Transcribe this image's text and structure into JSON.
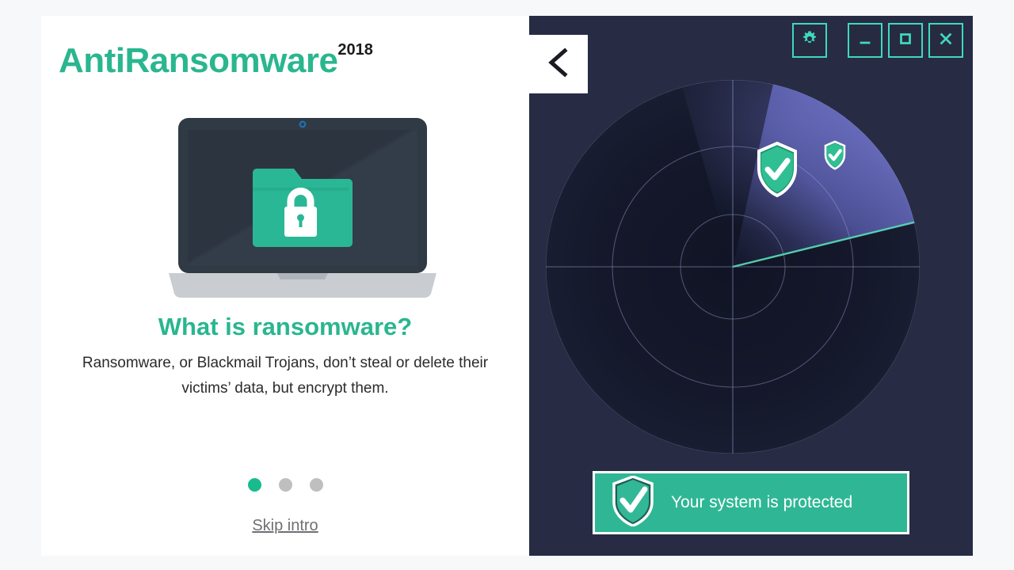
{
  "intro": {
    "app_name": "AntiRansomware",
    "year_badge": "2018",
    "illustration": "laptop-with-locked-folder-icon",
    "headline": "What is ransomware?",
    "description": "Ransomware, or Blackmail Trojans, don’t steal or delete their victims’ data, but encrypt them.",
    "pagination": {
      "total": 3,
      "active_index": 0
    },
    "skip_label": "Skip intro"
  },
  "app_window": {
    "back_icon": "chevron-left-icon",
    "controls": [
      {
        "name": "settings-button",
        "icon": "gear-icon"
      },
      {
        "name": "minimize-button",
        "icon": "minimize-icon"
      },
      {
        "name": "maximize-button",
        "icon": "maximize-icon"
      },
      {
        "name": "close-button",
        "icon": "close-icon"
      }
    ],
    "radar": {
      "rings": 3,
      "sweep_icon": "radar-sweep",
      "detections": [
        {
          "name": "shield-check-large",
          "icon": "shield-check-icon"
        },
        {
          "name": "shield-check-small",
          "icon": "shield-check-icon"
        }
      ]
    },
    "status": {
      "icon": "shield-check-icon",
      "text": "Your system is protected"
    }
  },
  "colors": {
    "brand_teal": "#2ab68f",
    "accent_teal": "#3fd9bb",
    "banner_teal": "#2fb795",
    "panel_dark": "#272c44",
    "radar_sweep": "#6b6fc4",
    "page_bg": "#f7f8f9",
    "dot_inactive": "#bfbfbf"
  }
}
